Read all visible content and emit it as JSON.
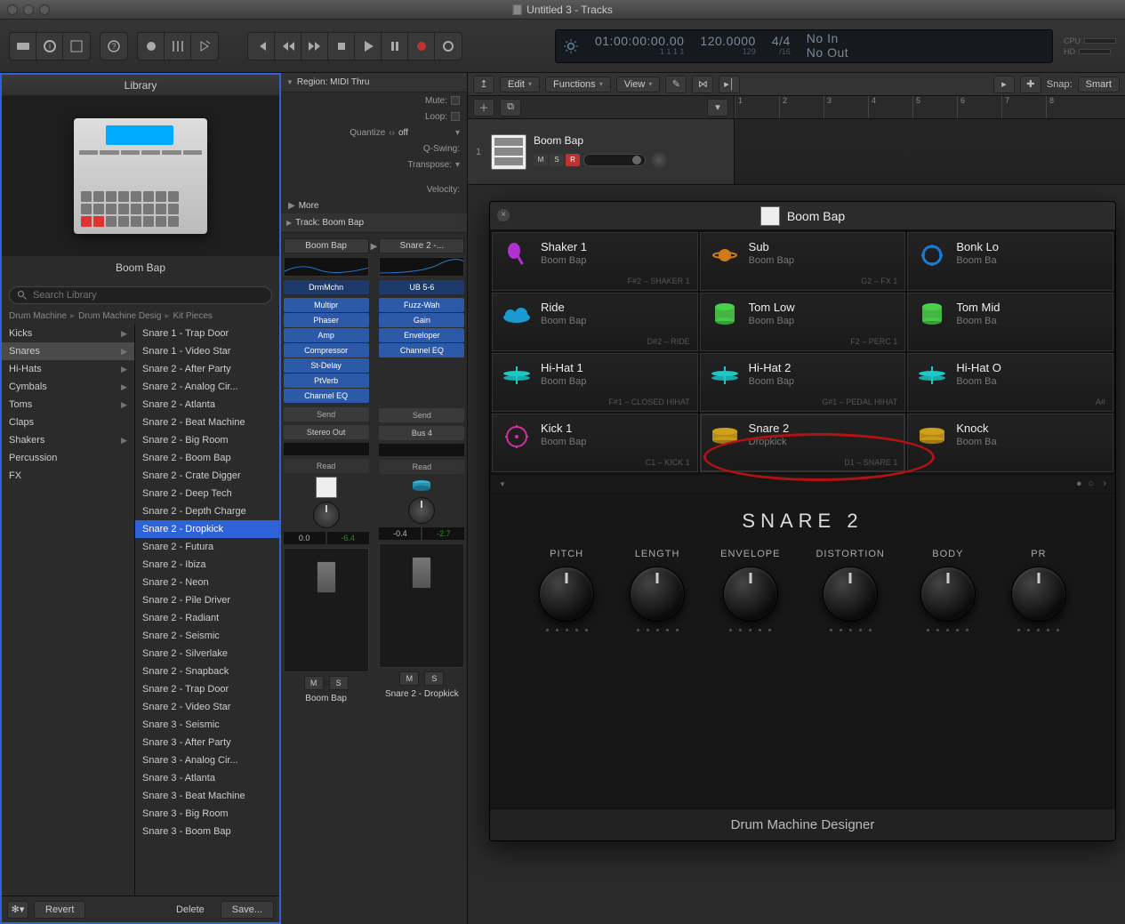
{
  "title": "Untitled 3 - Tracks",
  "lcd": {
    "smpte": "01:00:00:00.00",
    "beats": "1 1 1   1",
    "tempo": "120.0000",
    "tempo_sub": "129",
    "sig": "4/4",
    "sig_sub": "/16",
    "in": "No In",
    "out": "No Out",
    "cpu": "CPU",
    "hd": "HD"
  },
  "library": {
    "title": "Library",
    "instrument_name": "Boom Bap",
    "search_placeholder": "Search Library",
    "crumbs": [
      "Drum Machine",
      "Drum Machine Desig",
      "Kit Pieces"
    ],
    "categories": [
      {
        "name": "Kicks",
        "chev": true
      },
      {
        "name": "Snares",
        "chev": true,
        "selected": true
      },
      {
        "name": "Hi-Hats",
        "chev": true
      },
      {
        "name": "Cymbals",
        "chev": true
      },
      {
        "name": "Toms",
        "chev": true
      },
      {
        "name": "Claps"
      },
      {
        "name": "Shakers",
        "chev": true
      },
      {
        "name": "Percussion"
      },
      {
        "name": "FX"
      }
    ],
    "items": [
      "Snare 1 - Trap Door",
      "Snare 1 - Video Star",
      "Snare 2 - After Party",
      "Snare 2 - Analog Cir...",
      "Snare 2 - Atlanta",
      "Snare 2 - Beat Machine",
      "Snare 2 - Big Room",
      "Snare 2 - Boom Bap",
      "Snare 2 - Crate Digger",
      "Snare 2 - Deep Tech",
      "Snare 2 - Depth Charge",
      "Snare 2 - Dropkick",
      "Snare 2 - Futura",
      "Snare 2 - Ibiza",
      "Snare 2 - Neon",
      "Snare 2 - Pile Driver",
      "Snare 2 - Radiant",
      "Snare 2 - Seismic",
      "Snare 2 - Silverlake",
      "Snare 2 - Snapback",
      "Snare 2 - Trap Door",
      "Snare 2 - Video Star",
      "Snare 3  - Seismic",
      "Snare 3 - After Party",
      "Snare 3 - Analog Cir...",
      "Snare 3 - Atlanta",
      "Snare 3 - Beat Machine",
      "Snare 3 - Big Room",
      "Snare 3 - Boom Bap"
    ],
    "selected_item": "Snare 2 - Dropkick",
    "footer": {
      "revert": "Revert",
      "delete": "Delete",
      "save": "Save..."
    }
  },
  "inspector": {
    "region": {
      "title": "Region: MIDI Thru",
      "mute": "Mute:",
      "loop": "Loop:",
      "quantize": "Quantize",
      "quantize_val": "off",
      "qswing": "Q-Swing:",
      "transpose": "Transpose:",
      "velocity": "Velocity:",
      "more": "More"
    },
    "track": {
      "title": "Track:  Boom Bap"
    },
    "strip_a": {
      "name": "Boom Bap",
      "inst": "DrmMchn",
      "inserts": [
        "Multipr",
        "Phaser",
        "Amp",
        "Compressor",
        "St-Delay",
        "PtVerb",
        "Channel EQ"
      ],
      "send": "Send",
      "out": "Stereo Out",
      "auto": "Read",
      "pan": "0.0",
      "gain": "-6.4",
      "track": "Boom Bap"
    },
    "strip_b": {
      "name": "Snare 2 -...",
      "inst": "UB 5-6",
      "inserts": [
        "Fuzz-Wah",
        "Gain",
        "Enveloper",
        "Channel EQ"
      ],
      "send": "Send",
      "out": "Bus 4",
      "auto": "Read",
      "pan": "-0.4",
      "gain": "-2.7",
      "track": "Snare 2 - Dropkick"
    },
    "ms": {
      "m": "M",
      "s": "S"
    }
  },
  "tracks": {
    "menus": {
      "edit": "Edit",
      "functions": "Functions",
      "view": "View",
      "snap": "Snap:",
      "snap_val": "Smart"
    },
    "track": {
      "num": "1",
      "name": "Boom Bap",
      "m": "M",
      "s": "S",
      "r": "R"
    },
    "ruler": [
      "1",
      "2",
      "3",
      "4",
      "5",
      "6",
      "7",
      "8"
    ]
  },
  "plugin": {
    "title": "Boom Bap",
    "pads": [
      {
        "name": "Shaker 1",
        "kit": "Boom Bap",
        "note": "F#2 – SHAKER 1",
        "color": "#b030d0",
        "shape": "maraca"
      },
      {
        "name": "Sub",
        "kit": "Boom Bap",
        "note": "G2 – FX 1",
        "color": "#d07a1a",
        "shape": "planet"
      },
      {
        "name": "Bonk Lo",
        "kit": "Boom Ba",
        "note": "",
        "color": "#1a7ad0",
        "shape": "tamb"
      },
      {
        "name": "Ride",
        "kit": "Boom Bap",
        "note": "D#2 – RIDE",
        "color": "#1a9ad0",
        "shape": "cloud"
      },
      {
        "name": "Tom Low",
        "kit": "Boom Bap",
        "note": "F2 – PERC 1",
        "color": "#4ad04a",
        "shape": "tom"
      },
      {
        "name": "Tom Mid",
        "kit": "Boom Ba",
        "note": "",
        "color": "#4ad04a",
        "shape": "tom"
      },
      {
        "name": "Hi-Hat 1",
        "kit": "Boom Bap",
        "note": "F#1 – CLOSED HIHAT",
        "color": "#1acaca",
        "shape": "hihat"
      },
      {
        "name": "Hi-Hat 2",
        "kit": "Boom Bap",
        "note": "G#1 – PEDAL HIHAT",
        "color": "#1acaca",
        "shape": "hihat"
      },
      {
        "name": "Hi-Hat O",
        "kit": "Boom Ba",
        "note": "A#",
        "color": "#1acaca",
        "shape": "hihat"
      },
      {
        "name": "Kick 1",
        "kit": "Boom Bap",
        "note": "C1 – KICK 1",
        "color": "#d030a0",
        "shape": "kick"
      },
      {
        "name": "Snare 2",
        "kit": "Dropkick",
        "note": "D1 – SNARE 1",
        "color": "#d0a01a",
        "shape": "snare",
        "hl": true
      },
      {
        "name": "Knock",
        "kit": "Boom Ba",
        "note": "",
        "color": "#d0a01a",
        "shape": "snare"
      }
    ],
    "editor": {
      "title": "SNARE 2",
      "knobs": [
        "PITCH",
        "LENGTH",
        "ENVELOPE",
        "DISTORTION",
        "BODY",
        "PR"
      ]
    },
    "footer": "Drum Machine Designer"
  }
}
